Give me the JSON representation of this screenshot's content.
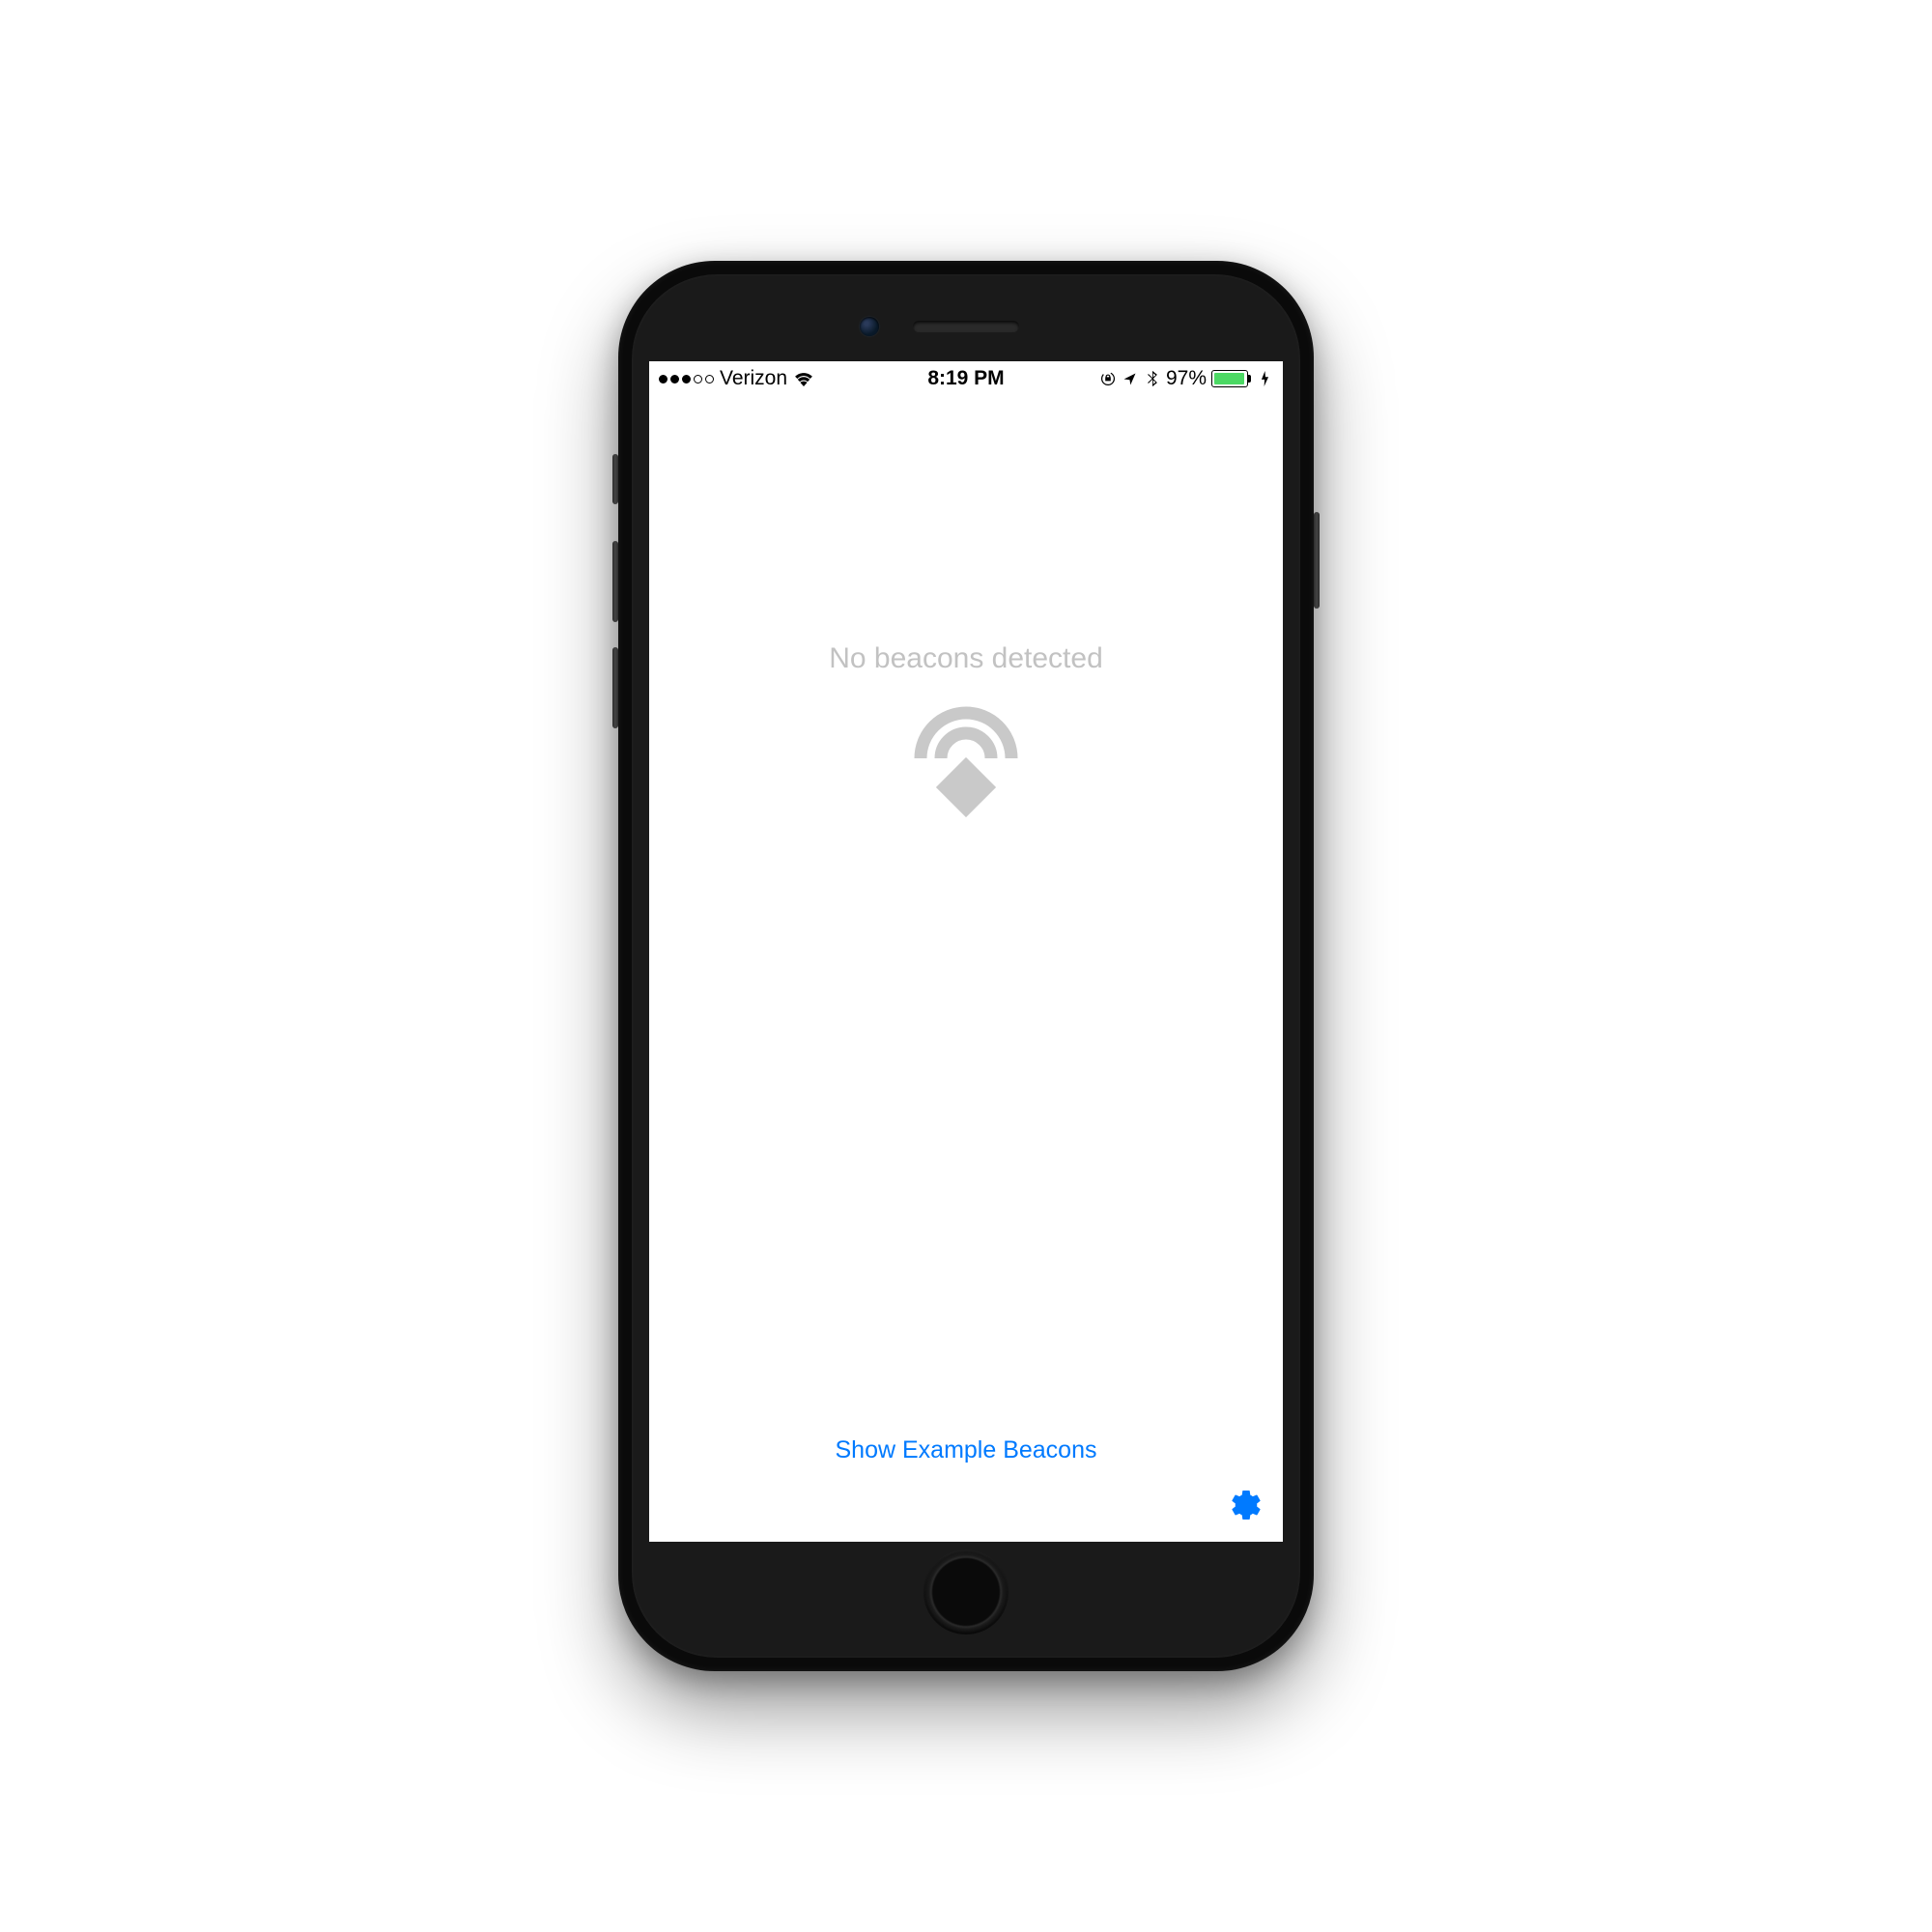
{
  "statusBar": {
    "carrier": "Verizon",
    "time": "8:19 PM",
    "battery": "97%"
  },
  "emptyState": {
    "text": "No beacons detected"
  },
  "bottomLink": {
    "label": "Show Example Beacons"
  },
  "colors": {
    "accent": "#007aff",
    "placeholder": "#c2c2c2",
    "batteryGreen": "#4cd964"
  }
}
